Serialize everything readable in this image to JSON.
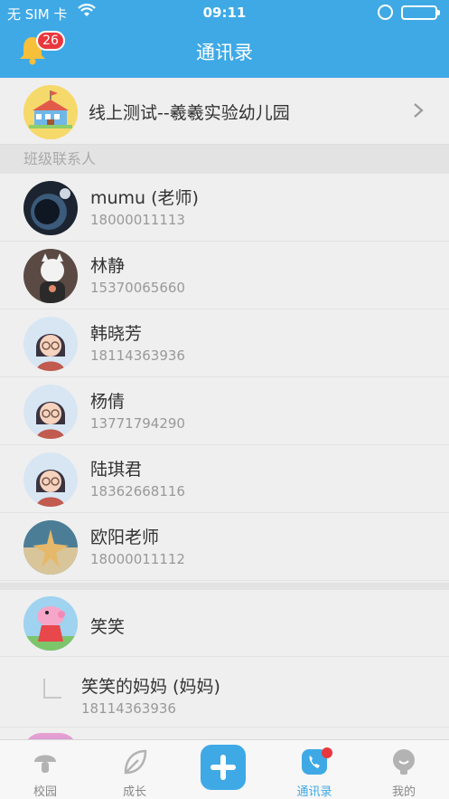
{
  "status_bar": {
    "carrier": "无 SIM 卡",
    "time": "09:11"
  },
  "header": {
    "title": "通讯录",
    "notification_count": "26"
  },
  "school": {
    "name": "线上测试--羲羲实验幼儿园"
  },
  "section_label": "班级联系人",
  "contacts": [
    {
      "name": "mumu (老师)",
      "phone": "18000011113"
    },
    {
      "name": "林静",
      "phone": "15370065660"
    },
    {
      "name": "韩晓芳",
      "phone": "18114363936"
    },
    {
      "name": "杨倩",
      "phone": "13771794290"
    },
    {
      "name": "陆琪君",
      "phone": "18362668116"
    },
    {
      "name": "欧阳老师",
      "phone": "18000011112"
    }
  ],
  "child": {
    "name": "笑笑",
    "parent": {
      "name": "笑笑的妈妈 (妈妈)",
      "phone": "18114363936"
    }
  },
  "tabs": [
    {
      "label": "校园"
    },
    {
      "label": "成长"
    },
    {
      "label": ""
    },
    {
      "label": "通讯录"
    },
    {
      "label": "我的"
    }
  ],
  "colors": {
    "accent": "#3fa9e6",
    "badge": "#e8383d",
    "battery": "#4cd964"
  }
}
